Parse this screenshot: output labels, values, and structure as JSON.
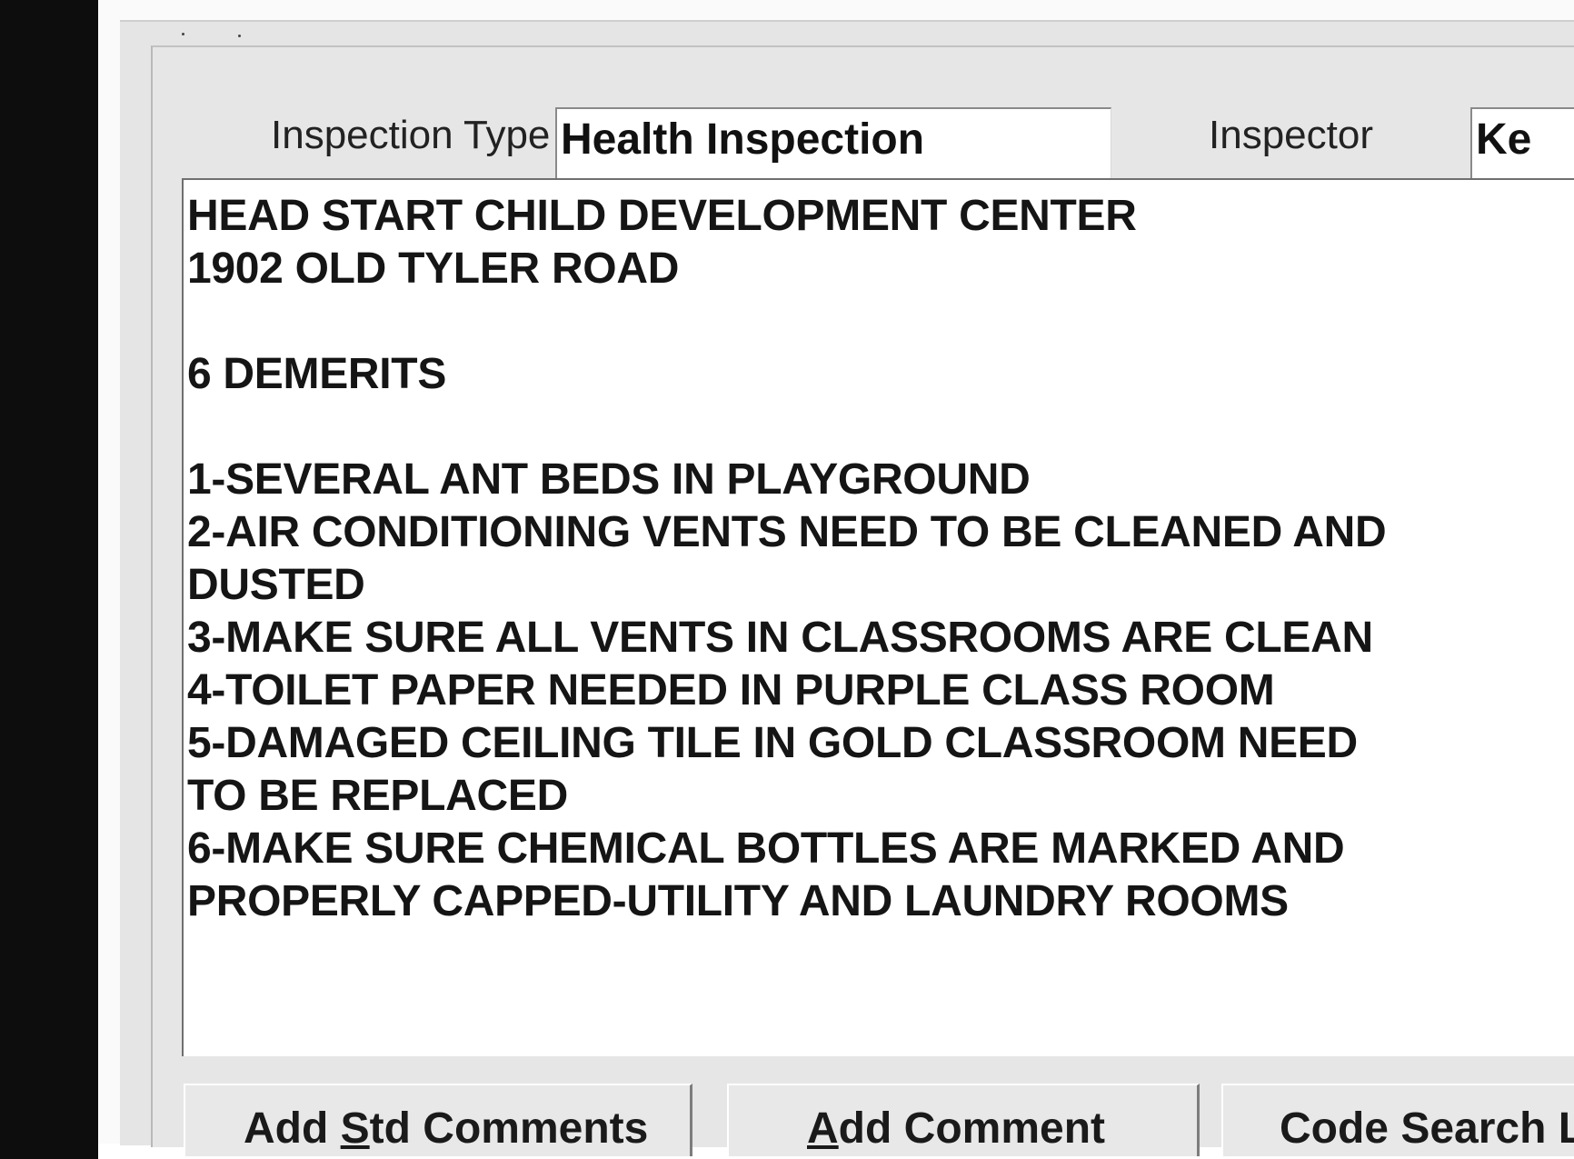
{
  "header": {
    "inspection_type_label": "Inspection Type",
    "inspection_type_value": "Health Inspection",
    "inspector_label": "Inspector",
    "inspector_value": "Ke"
  },
  "notes": {
    "lines": [
      "HEAD START CHILD DEVELOPMENT CENTER",
      "1902 OLD TYLER ROAD",
      "",
      "6 DEMERITS",
      "",
      "1-SEVERAL ANT BEDS IN PLAYGROUND",
      "2-AIR CONDITIONING VENTS NEED TO BE CLEANED AND",
      "DUSTED",
      "3-MAKE SURE ALL VENTS IN CLASSROOMS ARE CLEAN",
      "4-TOILET PAPER NEEDED IN PURPLE CLASS ROOM",
      "5-DAMAGED CEILING TILE IN GOLD CLASSROOM NEED",
      "TO BE REPLACED",
      "6-MAKE SURE CHEMICAL BOTTLES ARE MARKED AND",
      "PROPERLY CAPPED-UTILITY AND LAUNDRY ROOMS"
    ]
  },
  "buttons": {
    "add_std_comments": {
      "pre": "Add ",
      "accel": "S",
      "post": "td Comments"
    },
    "add_comment": {
      "pre": "",
      "accel": "A",
      "post": "dd Comment"
    },
    "code_search": {
      "label": "Code Search Li"
    }
  }
}
